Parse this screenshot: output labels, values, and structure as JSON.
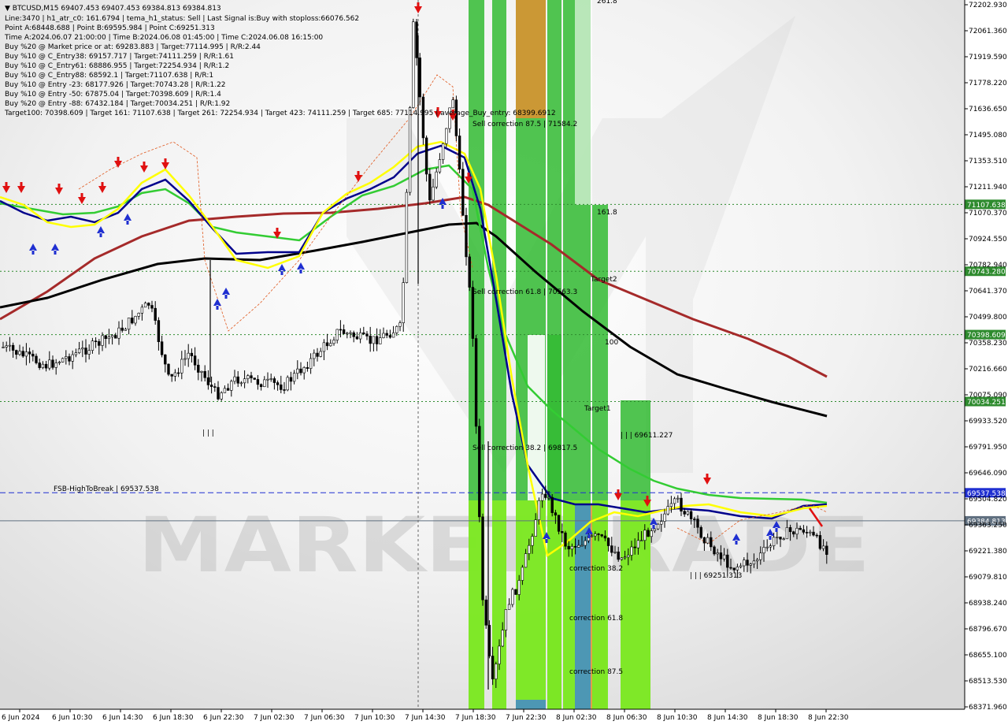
{
  "chart_data": {
    "type": "candlestick",
    "symbol_header": "BTCUSD,M15  69407.453 69407.453 69384.813 69384.813",
    "info_lines": [
      "Line:3470 | h1_atr_c0: 161.6794 | tema_h1_status: Sell | Last Signal is:Buy with stoploss:66076.562",
      "Point A:68448.688 | Point B:69595.984 | Point C:69251.313",
      "Time A:2024.06.07 21:00:00 | Time B:2024.06.08 01:45:00 | Time C:2024.06.08 16:15:00",
      "Buy %20 @ Market price or at: 69283.883 | Target:77114.995 | R/R:2.44",
      "Buy %10 @ C_Entry38: 69157.717 | Target:74111.259 | R/R:1.61",
      "Buy %10 @ C_Entry61: 68886.955 | Target:72254.934 | R/R:1.2",
      "Buy %10 @ C_Entry88: 68592.1 | Target:71107.638 | R/R:1",
      "Buy %10 @ Entry -23: 68177.926 | Target:70743.28 | R/R:1.22",
      "Buy %10 @ Entry -50: 67875.04 | Target:70398.609 | R/R:1.4",
      "Buy %20 @ Entry -88: 67432.184 | Target:70034.251 | R/R:1.92",
      "Target100: 70398.609 | Target 161: 71107.638 | Target 261: 72254.934 | Target 423: 74111.259 | Target 685: 77114.995 | average_Buy_entry: 68399.6912"
    ],
    "y_axis_ticks": [
      "72202.930",
      "72061.360",
      "71919.590",
      "71778.220",
      "71636.650",
      "71495.080",
      "71353.510",
      "71211.940",
      "71070.370",
      "70924.550",
      "70782.940",
      "70641.370",
      "70499.800",
      "70358.230",
      "70216.660",
      "70075.090",
      "69933.520",
      "69791.950",
      "69646.090",
      "69504.820",
      "69363.250",
      "69221.380",
      "69079.810",
      "68938.240",
      "68796.670",
      "68655.100",
      "68513.530",
      "68371.960"
    ],
    "y_range": [
      68371.96,
      72202.93
    ],
    "x_axis_ticks": [
      "6 Jun 2024",
      "6 Jun 10:30",
      "6 Jun 14:30",
      "6 Jun 18:30",
      "6 Jun 22:30",
      "7 Jun 02:30",
      "7 Jun 06:30",
      "7 Jun 10:30",
      "7 Jun 14:30",
      "7 Jun 18:30",
      "7 Jun 22:30",
      "8 Jun 02:30",
      "8 Jun 06:30",
      "8 Jun 10:30",
      "8 Jun 14:30",
      "8 Jun 18:30",
      "8 Jun 22:30"
    ],
    "levels": [
      {
        "value": 71107.638,
        "label": "71107.638",
        "style": "dotted",
        "color": "#2e8b2e"
      },
      {
        "value": 70743.28,
        "label": "70743.280",
        "style": "dotted",
        "color": "#2e8b2e"
      },
      {
        "value": 70398.609,
        "label": "70398.609",
        "style": "dotted",
        "color": "#2e8b2e"
      },
      {
        "value": 70034.251,
        "label": "70034.251",
        "style": "dotted",
        "color": "#2e8b2e"
      },
      {
        "value": 69537.538,
        "label": "69537.538",
        "style": "dashed",
        "color": "#1f2fd1"
      },
      {
        "value": 69384.813,
        "label": "69384.813",
        "style": "solid",
        "color": "#607080"
      }
    ],
    "annotations": [
      {
        "text": "FSB-HighToBreak | 69537.538",
        "color": "#000000"
      },
      {
        "text": "Sell correction 87.5 | 71584.2",
        "color": "#2a6a2a"
      },
      {
        "text": "Sell correction 61.8 | 70563.3",
        "color": "#2a6a2a"
      },
      {
        "text": "Sell correction 38.2 | 69817.5",
        "color": "#2a6a2a"
      },
      {
        "text": "161.8",
        "color": "#2a6a2a"
      },
      {
        "text": "Target2",
        "color": "#2a6a2a"
      },
      {
        "text": "100",
        "color": "#2a6a2a"
      },
      {
        "text": "Target1",
        "color": "#2a6a2a"
      },
      {
        "text": "261.8",
        "color": "#2a6a2a"
      },
      {
        "text": "| | | 69611.227",
        "color": "#000000"
      },
      {
        "text": "| | | 69251.313",
        "color": "#1f2fd1"
      },
      {
        "text": "correction 38.2",
        "color": "#1f2fd1"
      },
      {
        "text": "correction 61.8",
        "color": "#1f2fd1"
      },
      {
        "text": "correction 87.5",
        "color": "#1f2fd1"
      },
      {
        "text": "| | |",
        "color": "#000000"
      }
    ],
    "watermark": "MARKETTRADE",
    "colors": {
      "ma_slow": "#000000",
      "ma_brown": "#a52a2a",
      "ma_green": "#33cc33",
      "ma_blue": "#00008b",
      "ma_yellow": "#ffff00",
      "zone_green": "#33bb33",
      "zone_lime": "#88ee22",
      "zone_orange": "#e09030",
      "zone_blue": "#4488cc",
      "label_green": "#2e8b2e",
      "label_blue": "#1f2fd1",
      "label_gray": "#4a5a6a",
      "arrow_up": "#1f2fd1",
      "arrow_down": "#e01010"
    }
  }
}
